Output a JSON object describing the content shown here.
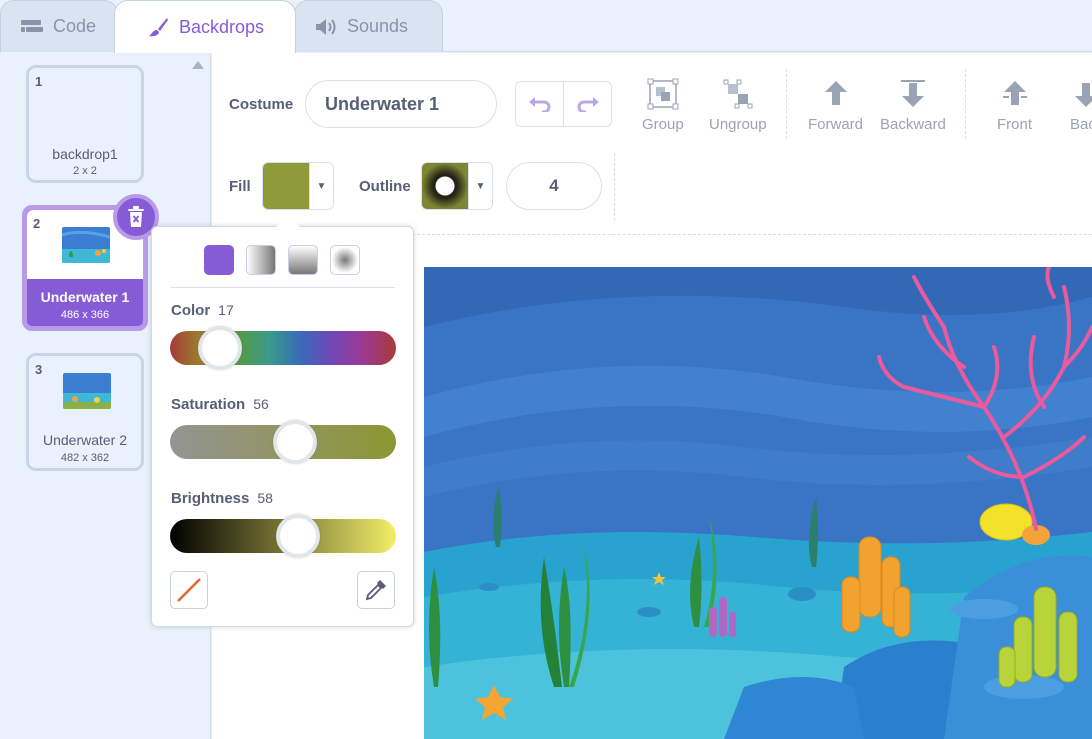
{
  "tabs": [
    {
      "label": "Code",
      "icon": "code-icon"
    },
    {
      "label": "Backdrops",
      "icon": "brush-icon",
      "active": true
    },
    {
      "label": "Sounds",
      "icon": "speaker-icon"
    }
  ],
  "backdrops": [
    {
      "number": "1",
      "name": "backdrop1",
      "size": "2 x 2"
    },
    {
      "number": "2",
      "name": "Underwater 1",
      "size": "486 x 366",
      "selected": true
    },
    {
      "number": "3",
      "name": "Underwater 2",
      "size": "482 x 362"
    }
  ],
  "editor": {
    "costume_label": "Costume",
    "costume_name": "Underwater 1",
    "tools": {
      "group": "Group",
      "ungroup": "Ungroup",
      "forward": "Forward",
      "backward": "Backward",
      "front": "Front",
      "back": "Bac"
    },
    "fill_label": "Fill",
    "outline_label": "Outline",
    "outline_width": "4",
    "fill_color": "#8f9a3a",
    "outline_color": "#2b2b1a"
  },
  "color_picker": {
    "color_label": "Color",
    "color_value": "17",
    "saturation_label": "Saturation",
    "saturation_value": "56",
    "brightness_label": "Brightness",
    "brightness_value": "58",
    "color_fraction": 0.17,
    "saturation_fraction": 0.56,
    "brightness_fraction": 0.58
  },
  "colors": {
    "accent": "#855cd6",
    "text": "#575e75"
  }
}
